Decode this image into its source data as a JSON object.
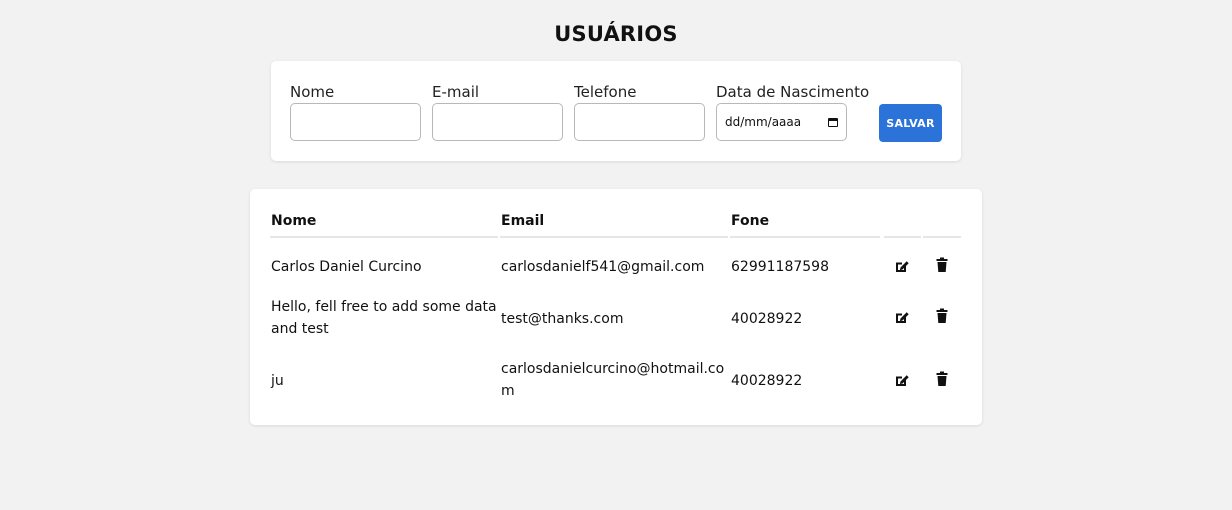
{
  "page": {
    "title": "USUÁRIOS"
  },
  "form": {
    "name_label": "Nome",
    "email_label": "E-mail",
    "phone_label": "Telefone",
    "birth_label": "Data de Nascimento",
    "birth_placeholder": "dd/mm/aaaa",
    "name_value": "",
    "email_value": "",
    "phone_value": "",
    "save_label": "SALVAR"
  },
  "table": {
    "columns": {
      "name": "Nome",
      "email": "Email",
      "phone": "Fone"
    },
    "rows": [
      {
        "name": "Carlos Daniel Curcino",
        "email": "carlosdanielf541@gmail.com",
        "phone": "62991187598"
      },
      {
        "name": "Hello, fell free to add some data and test",
        "email": "test@thanks.com",
        "phone": "40028922"
      },
      {
        "name": "ju",
        "email": "carlosdanielcurcino@hotmail.com",
        "phone": "40028922"
      }
    ],
    "row_icons": [
      "edit-icon",
      "trash-icon"
    ]
  },
  "colors": {
    "accent": "#2b72d9",
    "background": "#f2f2f2",
    "card": "#ffffff"
  }
}
